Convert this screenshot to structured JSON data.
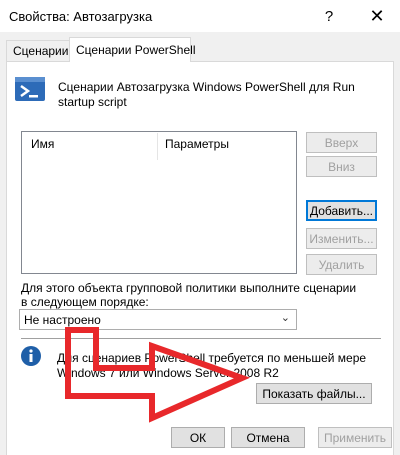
{
  "window": {
    "title": "Свойства: Автозагрузка",
    "help_glyph": "?",
    "close_glyph": "✕"
  },
  "tabs": [
    {
      "label": "Сценарии",
      "selected": false
    },
    {
      "label": "Сценарии PowerShell",
      "selected": true
    }
  ],
  "header": {
    "icon": "powershell-icon",
    "text": "Сценарии Автозагрузка Windows PowerShell для Run startup script"
  },
  "list": {
    "columns": [
      "Имя",
      "Параметры"
    ]
  },
  "side_buttons": {
    "up": "Вверх",
    "down": "Вниз",
    "add": "Добавить...",
    "edit": "Изменить...",
    "remove": "Удалить"
  },
  "order": {
    "label": "Для этого объекта групповой политики выполните сценарии в следующем порядке:",
    "selected": "Не настроено"
  },
  "info": {
    "icon": "info-icon",
    "text": "Для сценариев PowerShell требуется по меньшей мере Windows 7 или Windows Server 2008 R2"
  },
  "show_files_button": "Показать файлы...",
  "footer": {
    "ok": "ОК",
    "cancel": "Отмена",
    "apply": "Применить"
  },
  "colors": {
    "annotation_arrow": "#e8282b",
    "focus_border": "#0078d7",
    "powershell_blue": "#2d6bb8"
  }
}
